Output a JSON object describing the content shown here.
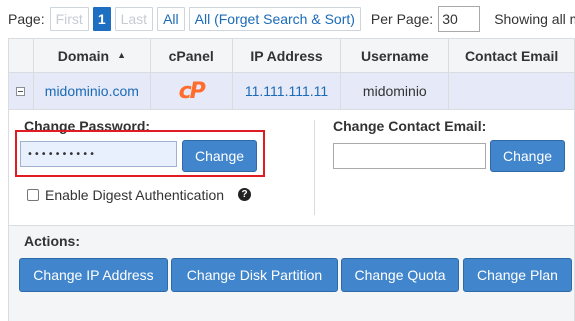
{
  "pager": {
    "page_label": "Page:",
    "first": "First",
    "current_page": "1",
    "last": "Last",
    "all": "All",
    "all_forget": "All (Forget Search & Sort)",
    "per_page_label": "Per Page:",
    "per_page_value": "30",
    "showing_text": "Showing all m"
  },
  "table": {
    "columns": [
      "Domain",
      "cPanel",
      "IP Address",
      "Username",
      "Contact Email"
    ],
    "sort_indicator": "▲",
    "row": {
      "domain": "midominio.com",
      "cpanel_logo": "cP",
      "ip": "11.111.111.11",
      "username": "midominio",
      "email": ""
    }
  },
  "password": {
    "label": "Change Password:",
    "value": "••••••••••",
    "button": "Change",
    "digest_label": "Enable Digest Authentication",
    "help_glyph": "?"
  },
  "email": {
    "label": "Change Contact Email:",
    "value": "",
    "button": "Change"
  },
  "actions": {
    "label": "Actions:",
    "buttons": [
      "Change IP Address",
      "Change Disk Partition",
      "Change Quota",
      "Change Plan"
    ]
  },
  "colors": {
    "button_blue": "#4185cc",
    "link_blue": "#1b6bb7",
    "highlight_red": "#e01b22",
    "cpanel_orange": "#ff6c2c",
    "row_bg": "#e6e9f7"
  },
  "icons": [
    "collapse-icon",
    "sort-asc-icon",
    "cpanel-logo-icon",
    "help-icon",
    "checkbox"
  ]
}
